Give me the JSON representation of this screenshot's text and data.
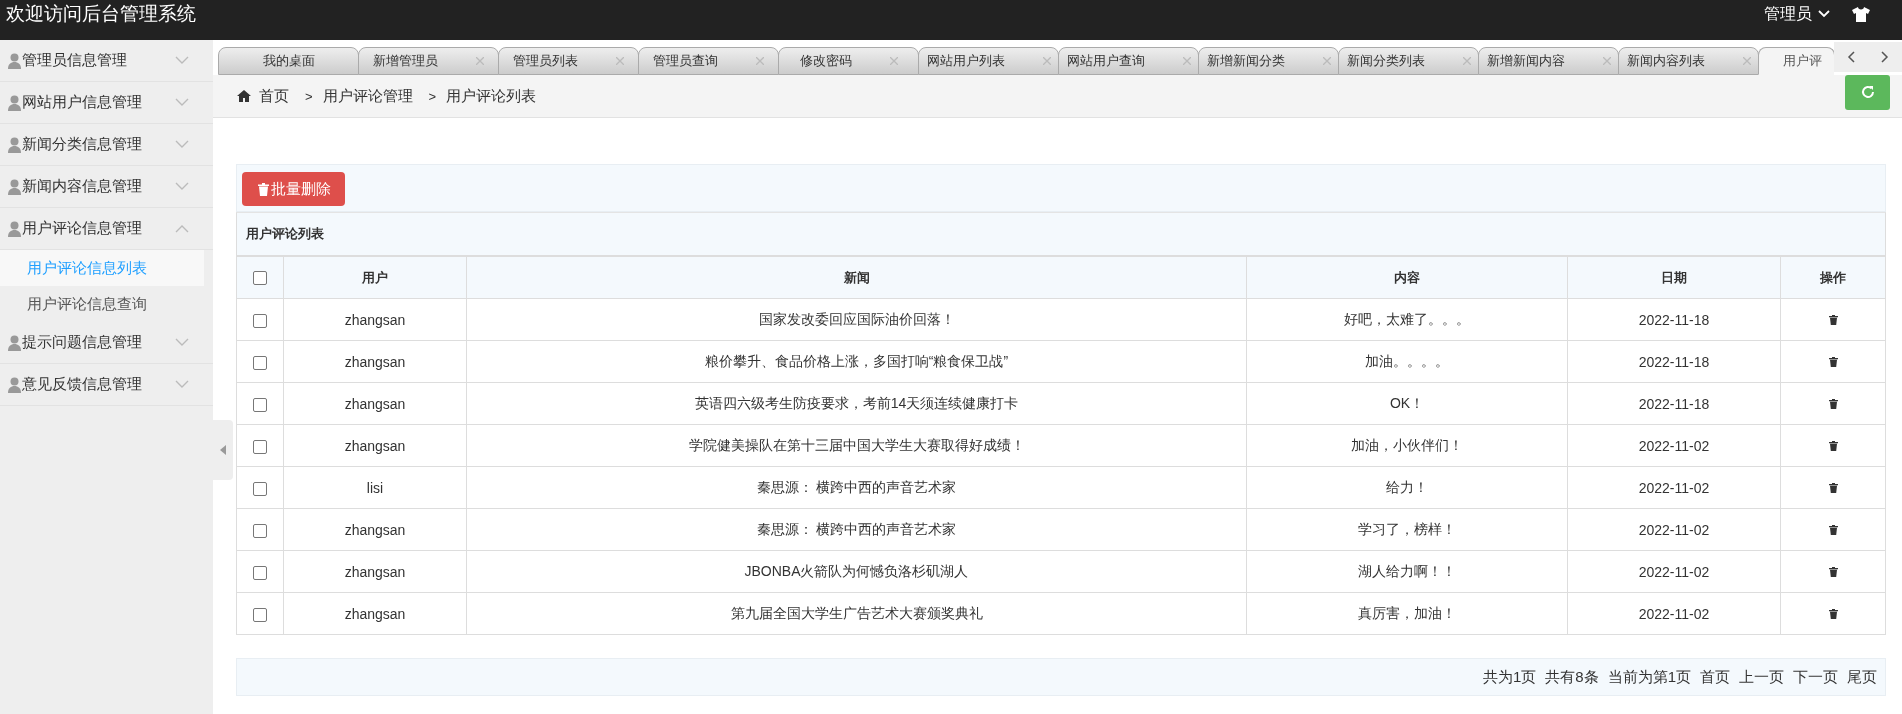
{
  "header": {
    "title": "欢迎访问后台管理系统",
    "user": "管理员"
  },
  "sidebar": {
    "groups": [
      {
        "label": "管理员信息管理",
        "expanded": false
      },
      {
        "label": "网站用户信息管理",
        "expanded": false
      },
      {
        "label": "新闻分类信息管理",
        "expanded": false
      },
      {
        "label": "新闻内容信息管理",
        "expanded": false
      },
      {
        "label": "用户评论信息管理",
        "expanded": true,
        "children": [
          {
            "label": "用户评论信息列表",
            "selected": true
          },
          {
            "label": "用户评论信息查询",
            "selected": false
          }
        ]
      },
      {
        "label": "提示问题信息管理",
        "expanded": false
      },
      {
        "label": "意见反馈信息管理",
        "expanded": false
      }
    ]
  },
  "tabs": [
    {
      "label": "我的桌面",
      "selected": false,
      "closable": false
    },
    {
      "label": "新增管理员",
      "selected": false,
      "closable": true
    },
    {
      "label": "管理员列表",
      "selected": false,
      "closable": true
    },
    {
      "label": "管理员查询",
      "selected": false,
      "closable": true
    },
    {
      "label": "修改密码",
      "selected": false,
      "closable": true
    },
    {
      "label": "网站用户列表",
      "selected": false,
      "closable": true
    },
    {
      "label": "网站用户查询",
      "selected": false,
      "closable": true
    },
    {
      "label": "新增新闻分类",
      "selected": false,
      "closable": true
    },
    {
      "label": "新闻分类列表",
      "selected": false,
      "closable": true
    },
    {
      "label": "新增新闻内容",
      "selected": false,
      "closable": true
    },
    {
      "label": "新闻内容列表",
      "selected": false,
      "closable": true
    },
    {
      "label": "用户评",
      "selected": true,
      "closable": false
    }
  ],
  "breadcrumb": [
    "首页",
    "用户评论管理",
    "用户评论列表"
  ],
  "breadcrumb_separator": ">",
  "bulk_delete": "批量删除",
  "table": {
    "title": "用户评论列表",
    "select_all": {
      "checked": false
    },
    "columns": [
      "用户",
      "新闻",
      "内容",
      "日期",
      "操作"
    ],
    "rows": [
      {
        "checked": false,
        "user": "zhangsan",
        "news": "国家发改委回应国际油价回落！",
        "content": "好吧，太难了。。。",
        "date": "2022-11-18"
      },
      {
        "checked": false,
        "user": "zhangsan",
        "news": "粮价攀升、食品价格上涨，多国打响“粮食保卫战”",
        "content": "加油。。。。",
        "date": "2022-11-18"
      },
      {
        "checked": false,
        "user": "zhangsan",
        "news": "英语四六级考生防疫要求，考前14天须连续健康打卡",
        "content": "OK！",
        "date": "2022-11-18"
      },
      {
        "checked": false,
        "user": "zhangsan",
        "news": "学院健美操队在第十三届中国大学生大赛取得好成绩！",
        "content": "加油，小伙伴们！",
        "date": "2022-11-02"
      },
      {
        "checked": false,
        "user": "lisi",
        "news": "秦思源： 横跨中西的声音艺术家",
        "content": "给力！",
        "date": "2022-11-02"
      },
      {
        "checked": false,
        "user": "zhangsan",
        "news": "秦思源： 横跨中西的声音艺术家",
        "content": "学习了，榜样！",
        "date": "2022-11-02"
      },
      {
        "checked": false,
        "user": "zhangsan",
        "news": "JBONBA火箭队为何憾负洛杉矶湖人",
        "content": "湖人给力啊！！",
        "date": "2022-11-02"
      },
      {
        "checked": false,
        "user": "zhangsan",
        "news": "第九届全国大学生广告艺术大赛颁奖典礼",
        "content": "真厉害，加油！",
        "date": "2022-11-02"
      }
    ]
  },
  "pagination": {
    "info": [
      "共为1页",
      "共有8条",
      "当前为第1页"
    ],
    "links": [
      "首页",
      "上一页",
      "下一页",
      "尾页"
    ]
  }
}
